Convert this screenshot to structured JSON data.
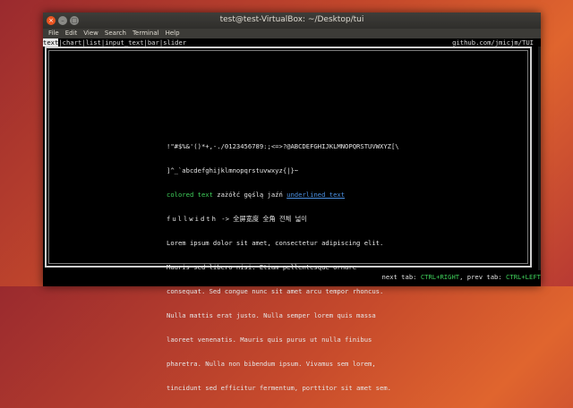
{
  "window": {
    "title": "test@test-VirtualBox: ~/Desktop/tui",
    "close_glyph": "×",
    "minimize_glyph": "–",
    "maximize_glyph": "□"
  },
  "menu": [
    "File",
    "Edit",
    "View",
    "Search",
    "Terminal",
    "Help"
  ],
  "tabs": {
    "items": [
      "text",
      "chart",
      "list",
      "input_text",
      "bar",
      "slider"
    ],
    "active": "text",
    "separator": "|",
    "link": "github.com/jmicjm/TUI"
  },
  "content": {
    "ascii_line_1": "!\"#$%&'()*+,-./0123456789:;<=>?@ABCDEFGHIJKLMNOPQRSTUVWXYZ[\\",
    "ascii_line_2": "]^_`abcdefghijklmnopqrstuvwxyz{|}~",
    "colored_text": "colored text",
    "polish_text": " zażółć gęślą jaźń ",
    "underlined_text": "underlined text",
    "fullwidth_label": "fullwidth",
    "fullwidth_arrow": "->",
    "fullwidth_text": "全屏宽度 全角 전체 넓이",
    "lorem": [
      "Lorem ipsum dolor sit amet, consectetur adipiscing elit.",
      "Mauris sed libero nisi. Etiam pellentesque ornare",
      "consequat. Sed congue nunc sit amet arcu tempor rhoncus.",
      "Nulla mattis erat justo. Nulla semper lorem quis massa",
      "laoreet venenatis. Mauris quis purus ut nulla finibus",
      "pharetra. Nulla non bibendum ipsum. Vivamus sem lorem,",
      "tincidunt sed efficitur fermentum, porttitor sit amet sem."
    ]
  },
  "footer": {
    "next_label": "next tab: ",
    "next_key": "CTRL+RIGHT",
    "prev_label": ", prev tab: ",
    "prev_key": "CTRL+LEFT"
  },
  "colors": {
    "accent_green": "#3fd15b",
    "link_blue": "#4a90e2",
    "ubuntu_orange": "#e95420"
  }
}
